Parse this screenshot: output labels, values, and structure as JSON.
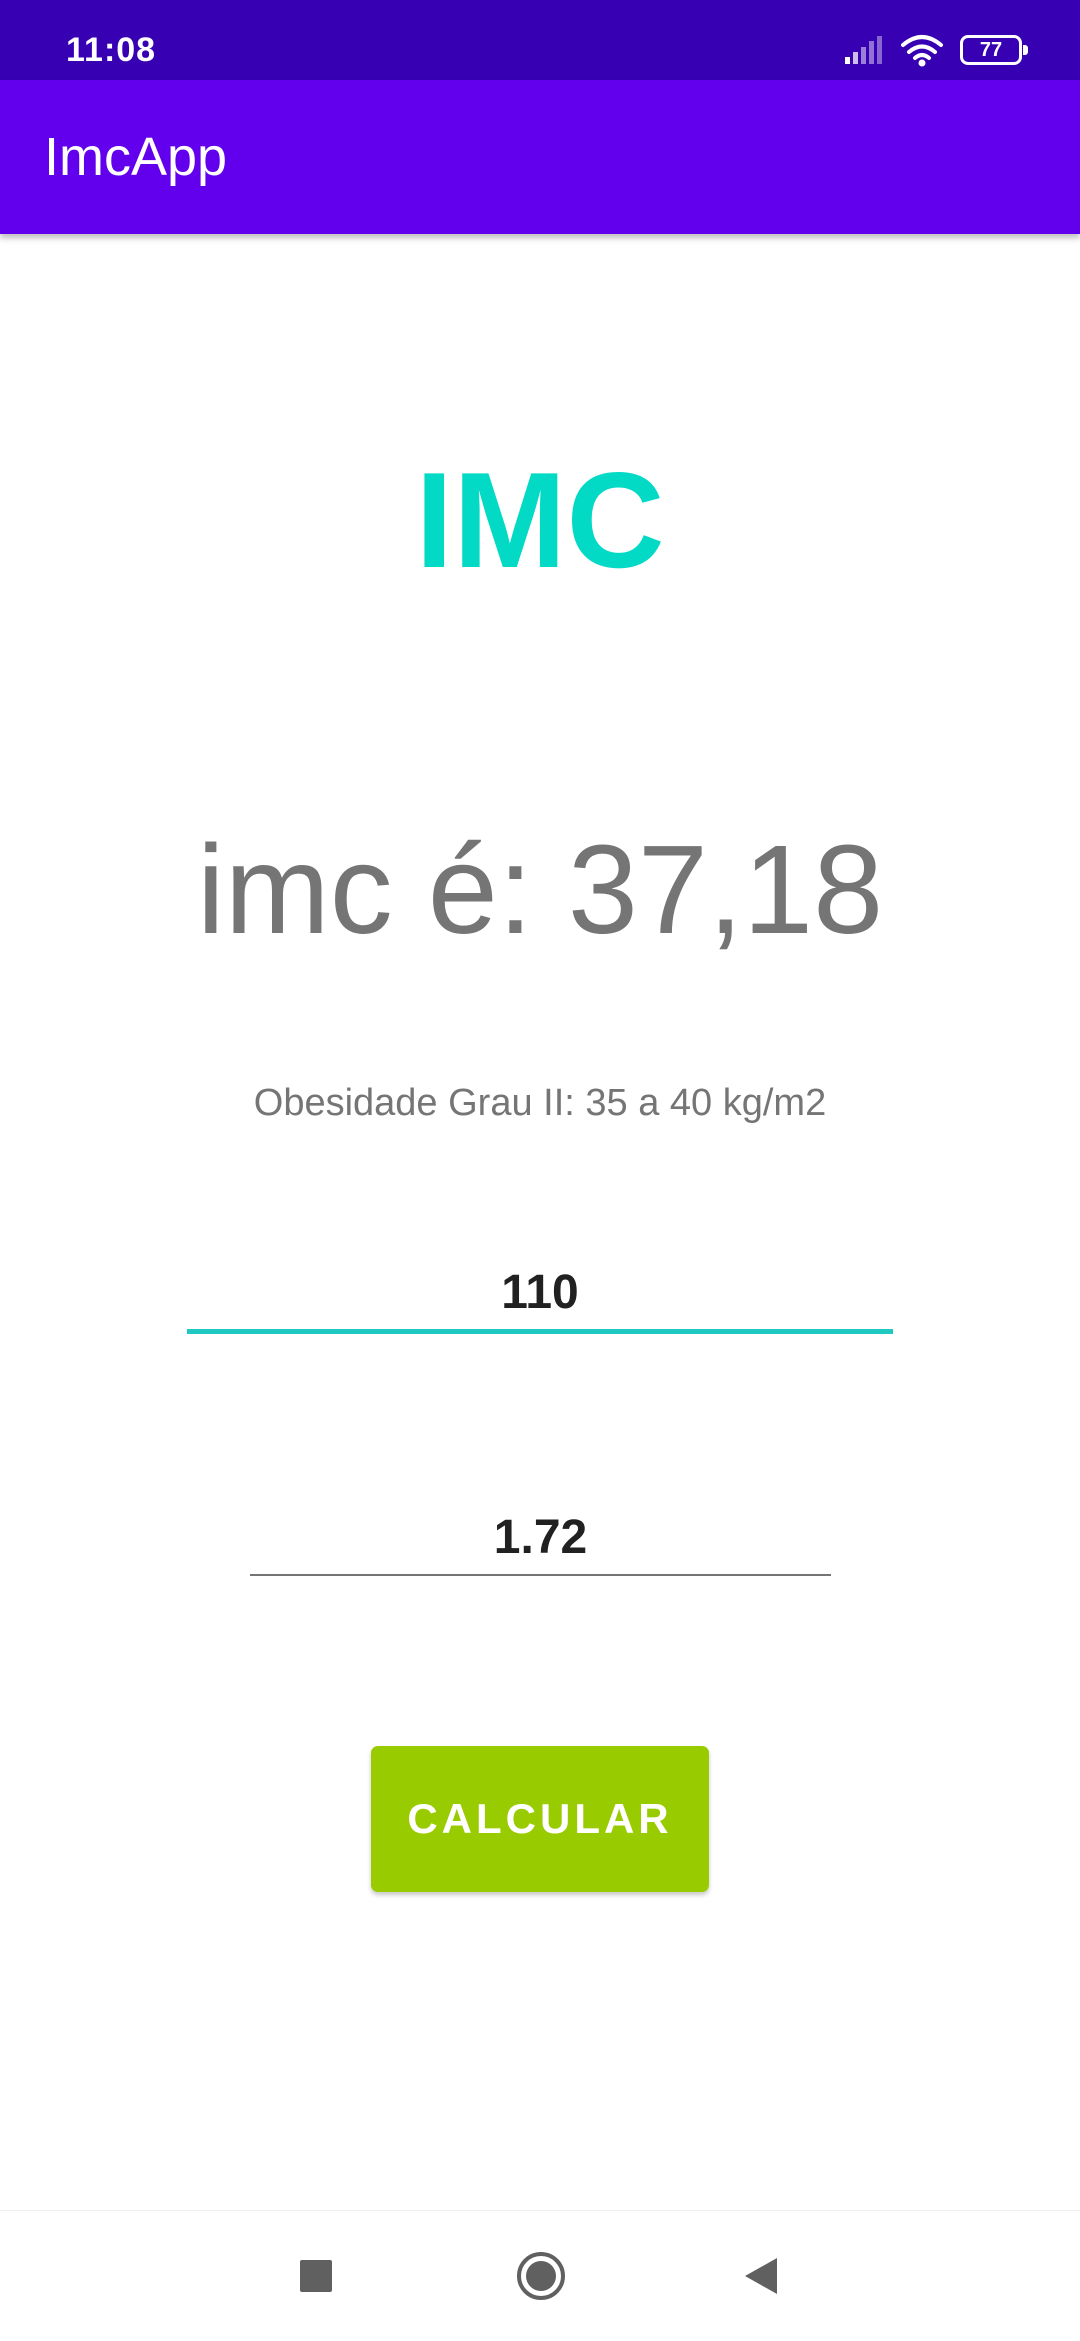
{
  "status_bar": {
    "time": "11:08",
    "battery_level": "77",
    "icons": [
      "signal-icon",
      "wifi-icon",
      "battery-icon"
    ]
  },
  "app_bar": {
    "title": "ImcApp"
  },
  "main": {
    "heading": "IMC",
    "result_text": "imc é: 37,18",
    "classification": "Obesidade Grau II: 35 a 40 kg/m2",
    "weight_value": "110",
    "height_value": "1.72",
    "calculate_label": "CALCULAR"
  },
  "nav_bar": {
    "buttons": [
      "recents-icon",
      "home-icon",
      "back-icon"
    ]
  },
  "colors": {
    "status_bar": "#3700b3",
    "app_bar": "#6200ee",
    "accent": "#03dac5",
    "focused_underline": "#1fc9c1",
    "button": "#99cc00",
    "text_secondary": "#757575",
    "text_primary": "#212121"
  }
}
